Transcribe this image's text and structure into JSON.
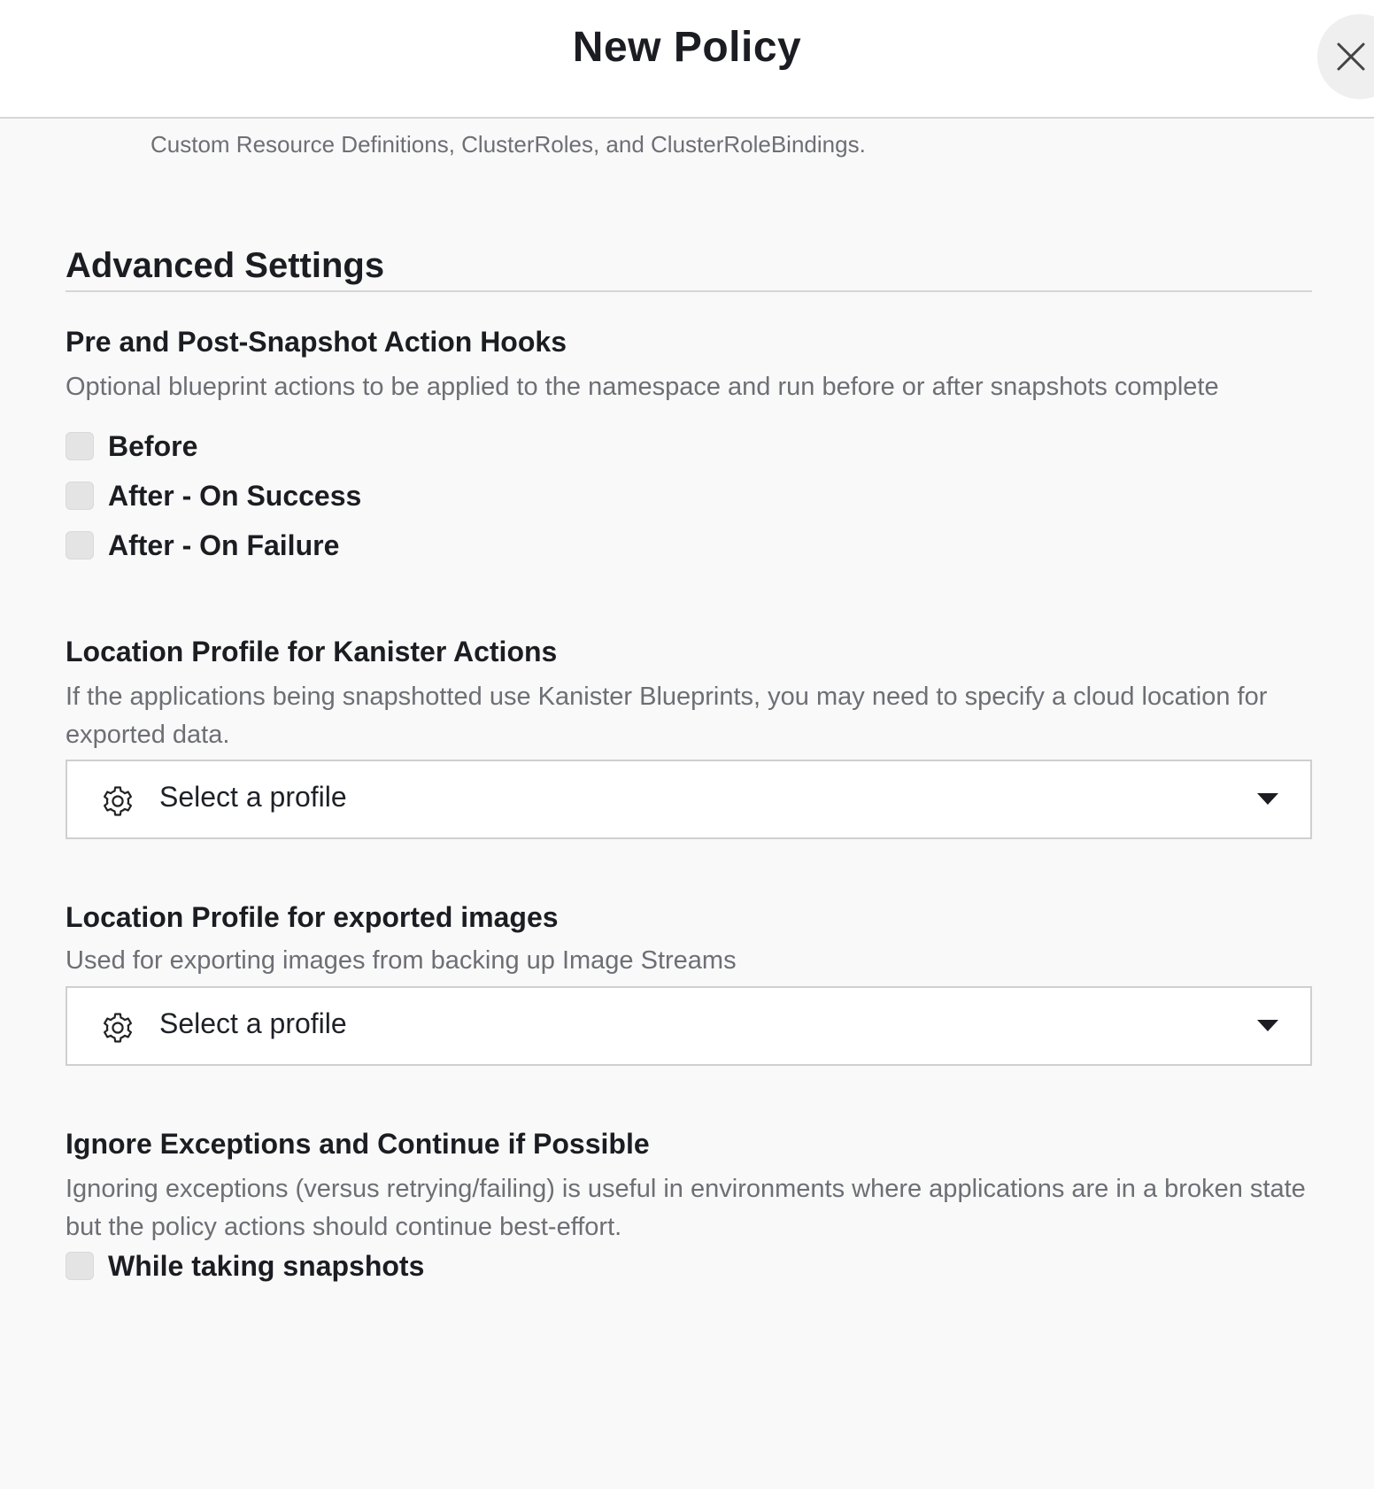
{
  "header": {
    "title": "New Policy",
    "close_icon": "close-icon"
  },
  "partial_text": "Custom Resource Definitions, ClusterRoles, and ClusterRoleBindings.",
  "advanced": {
    "title": "Advanced Settings",
    "hooks": {
      "title": "Pre and Post-Snapshot Action Hooks",
      "description": "Optional blueprint actions to be applied to the namespace and run before or after snapshots complete",
      "options": [
        {
          "label": "Before",
          "checked": false
        },
        {
          "label": "After - On Success",
          "checked": false
        },
        {
          "label": "After - On Failure",
          "checked": false
        }
      ]
    },
    "kanister": {
      "title": "Location Profile for Kanister Actions",
      "description": "If the applications being snapshotted use Kanister Blueprints, you may need to specify a cloud location for exported data.",
      "select_placeholder": "Select a profile",
      "icon": "gear-icon"
    },
    "images": {
      "title": "Location Profile for exported images",
      "description": "Used for exporting images from backing up Image Streams",
      "select_placeholder": "Select a profile",
      "icon": "gear-icon"
    },
    "exceptions": {
      "title": "Ignore Exceptions and Continue if Possible",
      "description": "Ignoring exceptions (versus retrying/failing) is useful in environments where applications are in a broken state but the policy actions should continue best-effort.",
      "options": [
        {
          "label": "While taking snapshots",
          "checked": false
        }
      ]
    }
  },
  "colors": {
    "background": "#f9f9f9",
    "header_background": "#ffffff",
    "text_primary": "#1b1d22",
    "text_secondary": "#6d6f75",
    "checkbox_fill": "#e4e4e4",
    "border": "#cfcfcf"
  }
}
